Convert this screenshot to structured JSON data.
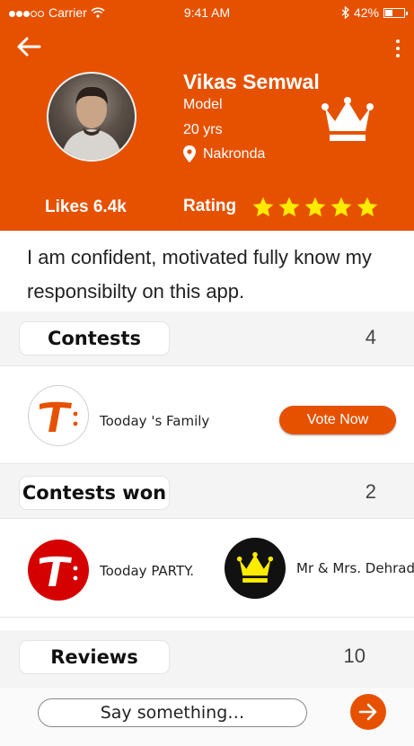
{
  "status_bar": {
    "carrier": "Carrier",
    "time": "9:41 AM",
    "battery": "42%",
    "battery_level": 0.42
  },
  "profile": {
    "name": "Vikas Semwal",
    "role": "Model",
    "age": "20 yrs",
    "location": "Nakronda",
    "likes": "Likes 6.4k",
    "rating_label": "Rating",
    "rating_stars": 5,
    "bio": "I am confident, motivated fully know my responsibilty on this app."
  },
  "contests": {
    "label": "Contests",
    "count": "4",
    "items": [
      {
        "name": "Tooday 's Family",
        "action": "Vote Now"
      }
    ]
  },
  "contests_won": {
    "label": "Contests won",
    "count": "2",
    "items": [
      {
        "name": "Tooday PARTY."
      },
      {
        "name": "Mr & Mrs. Dehradun"
      }
    ]
  },
  "reviews": {
    "label": "Reviews",
    "count": "10"
  },
  "composer": {
    "placeholder": "Say something…"
  },
  "colors": {
    "accent": "#E65100",
    "star": "#FFEB00",
    "logo_red": "#D50000",
    "logo_dark": "#111111"
  },
  "icons": [
    "back-arrow-icon",
    "more-vert-icon",
    "crown-icon",
    "location-pin-icon",
    "star-icon",
    "send-arrow-icon"
  ]
}
